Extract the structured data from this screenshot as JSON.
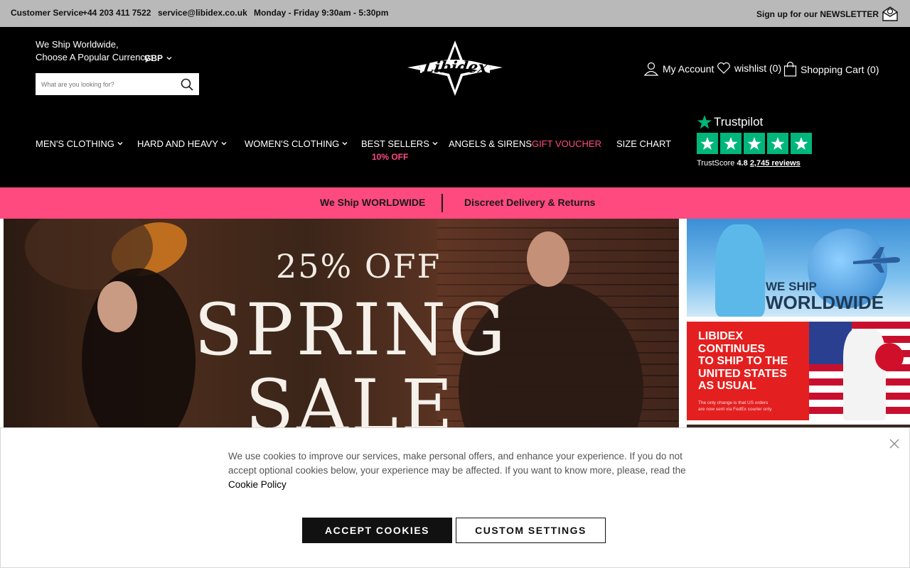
{
  "topbar": {
    "customer_service": "Customer Service",
    "phone": "+44 203 411 7522",
    "email": "service@libidex.co.uk",
    "hours": "Monday - Friday 9:30am - 5:30pm",
    "newsletter": "Sign up for our NEWSLETTER"
  },
  "header": {
    "ship_line1": "We Ship Worldwide,",
    "ship_line2": "Choose A Popular Currency:",
    "currency": "GBP",
    "search_placeholder": "What are you looking for?",
    "logo_text": "Libidex",
    "my_account": "My Account",
    "wishlist": "wishlist (0)",
    "cart": "Shopping Cart (0)"
  },
  "nav": {
    "mens": "MEN'S CLOTHING",
    "hard": "HARD AND HEAVY",
    "womens": "WOMEN'S CLOTHING",
    "best": "BEST SELLERS",
    "best_sub": "10% OFF",
    "angels": "ANGELS & SIRENS",
    "voucher": "GIFT VOUCHER",
    "size": "SIZE CHART"
  },
  "trustpilot": {
    "name": "Trustpilot",
    "score_label": "TrustScore",
    "score": "4.8",
    "reviews": "2,745 reviews"
  },
  "banner": {
    "left": "We Ship WORLDWIDE",
    "right": "Discreet Delivery & Returns"
  },
  "hero": {
    "discount": "25% OFF",
    "line1": "SPRING",
    "line2": "SALE"
  },
  "side": {
    "ship1": "WE SHIP",
    "ship2": "WORLDWIDE",
    "usa_heading": [
      "LIBIDEX",
      "CONTINUES",
      "TO SHIP TO THE",
      "UNITED STATES",
      "AS USUAL"
    ],
    "usa_small1": "The only change is that US orders",
    "usa_small2": "are now sent via FedEx courier only."
  },
  "cookie": {
    "text": "We use cookies to improve our services, make personal offers, and enhance your experience. If you do not accept optional cookies below, your experience may be affected. If you want to know more, please, read the ",
    "policy_link": "Cookie Policy",
    "accept": "ACCEPT COOKIES",
    "custom": "CUSTOM SETTINGS"
  },
  "colors": {
    "accent_pink": "#ff4a7f",
    "trustpilot_green": "#00b67a",
    "header_bg": "#000000",
    "topbar_bg": "#b9b9b9"
  }
}
